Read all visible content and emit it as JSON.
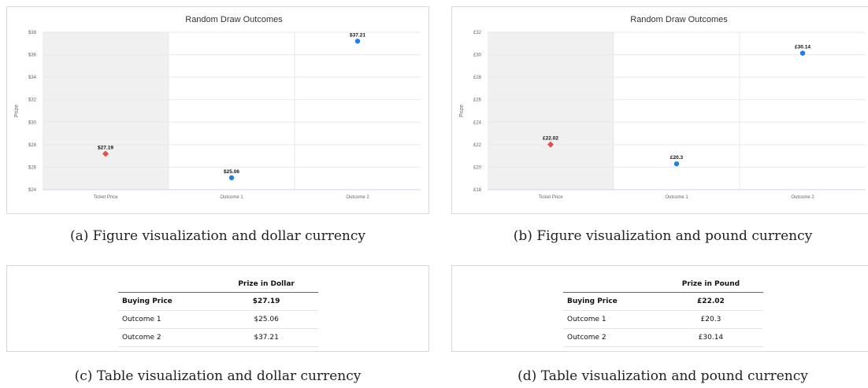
{
  "chart_data": [
    {
      "type": "scatter",
      "title": "Random Draw Outcomes",
      "ylabel": "Prize",
      "categories": [
        "Ticket Price",
        "Outcome 1",
        "Outcome 2"
      ],
      "values": [
        27.19,
        25.06,
        37.21
      ],
      "data_labels": [
        "$27.19",
        "$25.06",
        "$37.21"
      ],
      "marker_shapes": [
        "diamond",
        "circle",
        "circle"
      ],
      "marker_colors": [
        "#e0504d",
        "#1f7ee8",
        "#1f7ee8"
      ],
      "shaded_category": "Ticket Price",
      "ylim": [
        24,
        38
      ],
      "yticks": [
        24,
        26,
        28,
        30,
        32,
        34,
        36,
        38
      ],
      "ytick_labels": [
        "$24",
        "$26",
        "$28",
        "$30",
        "$32",
        "$34",
        "$36",
        "$38"
      ],
      "grid": true
    },
    {
      "type": "scatter",
      "title": "Random Draw Outcomes",
      "ylabel": "Prize",
      "categories": [
        "Ticket Price",
        "Outcome 1",
        "Outcome 2"
      ],
      "values": [
        22.02,
        20.3,
        30.14
      ],
      "data_labels": [
        "£22.02",
        "£20.3",
        "£30.14"
      ],
      "marker_shapes": [
        "diamond",
        "circle",
        "circle"
      ],
      "marker_colors": [
        "#e0504d",
        "#1f7ee8",
        "#1f7ee8"
      ],
      "shaded_category": "Ticket Price",
      "ylim": [
        18,
        32
      ],
      "yticks": [
        18,
        20,
        22,
        24,
        26,
        28,
        30,
        32
      ],
      "ytick_labels": [
        "£18",
        "£20",
        "£22",
        "£24",
        "£26",
        "£28",
        "£30",
        "£32"
      ],
      "grid": true
    }
  ],
  "tables": [
    {
      "header": [
        "",
        "Prize in Dollar"
      ],
      "rows": [
        {
          "label": "Buying Price",
          "value": "$27.19",
          "bold": true
        },
        {
          "label": "Outcome 1",
          "value": "$25.06",
          "bold": false
        },
        {
          "label": "Outcome 2",
          "value": "$37.21",
          "bold": false
        }
      ]
    },
    {
      "header": [
        "",
        "Prize in Pound"
      ],
      "rows": [
        {
          "label": "Buying Price",
          "value": "£22.02",
          "bold": true
        },
        {
          "label": "Outcome 1",
          "value": "£20.3",
          "bold": false
        },
        {
          "label": "Outcome 2",
          "value": "£30.14",
          "bold": false
        }
      ]
    }
  ],
  "captions": {
    "a": "(a) Figure visualization and dollar currency",
    "b": "(b) Figure visualization and pound currency",
    "c": "(c) Table visualization and dollar currency",
    "d": "(d) Table visualization and pound currency"
  }
}
